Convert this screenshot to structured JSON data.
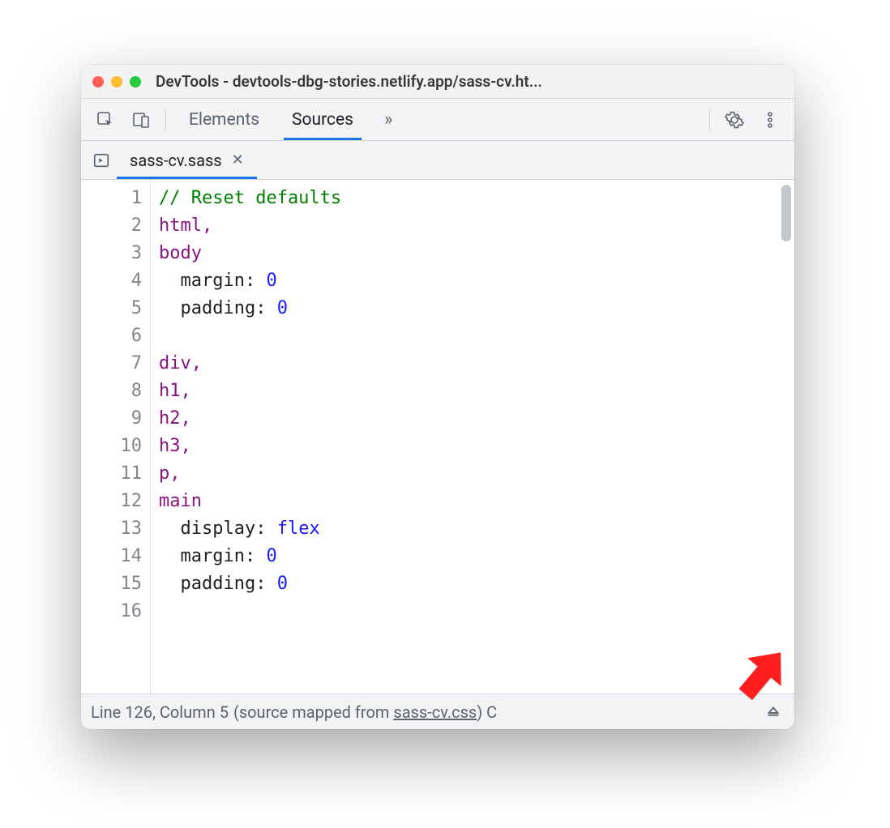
{
  "window": {
    "title": "DevTools - devtools-dbg-stories.netlify.app/sass-cv.ht..."
  },
  "panels": {
    "elements": "Elements",
    "sources": "Sources"
  },
  "file_tab": {
    "name": "sass-cv.sass"
  },
  "code_lines": [
    {
      "n": 1,
      "tokens": [
        {
          "t": "// Reset defaults",
          "c": "c-comment"
        }
      ]
    },
    {
      "n": 2,
      "tokens": [
        {
          "t": "html",
          "c": "c-sel"
        },
        {
          "t": ",",
          "c": "c-sel"
        }
      ]
    },
    {
      "n": 3,
      "tokens": [
        {
          "t": "body",
          "c": "c-sel"
        }
      ]
    },
    {
      "n": 4,
      "tokens": [
        {
          "t": "  margin",
          "c": "c-prop"
        },
        {
          "t": ": ",
          "c": ""
        },
        {
          "t": "0",
          "c": "c-val"
        }
      ]
    },
    {
      "n": 5,
      "tokens": [
        {
          "t": "  padding",
          "c": "c-prop"
        },
        {
          "t": ": ",
          "c": ""
        },
        {
          "t": "0",
          "c": "c-val"
        }
      ]
    },
    {
      "n": 6,
      "tokens": [
        {
          "t": " ",
          "c": ""
        }
      ]
    },
    {
      "n": 7,
      "tokens": [
        {
          "t": "div",
          "c": "c-sel"
        },
        {
          "t": ",",
          "c": "c-sel"
        }
      ]
    },
    {
      "n": 8,
      "tokens": [
        {
          "t": "h1",
          "c": "c-sel"
        },
        {
          "t": ",",
          "c": "c-sel"
        }
      ]
    },
    {
      "n": 9,
      "tokens": [
        {
          "t": "h2",
          "c": "c-sel"
        },
        {
          "t": ",",
          "c": "c-sel"
        }
      ]
    },
    {
      "n": 10,
      "tokens": [
        {
          "t": "h3",
          "c": "c-sel"
        },
        {
          "t": ",",
          "c": "c-sel"
        }
      ]
    },
    {
      "n": 11,
      "tokens": [
        {
          "t": "p",
          "c": "c-sel"
        },
        {
          "t": ",",
          "c": "c-sel"
        }
      ]
    },
    {
      "n": 12,
      "tokens": [
        {
          "t": "main",
          "c": "c-sel"
        }
      ]
    },
    {
      "n": 13,
      "tokens": [
        {
          "t": "  display",
          "c": "c-prop"
        },
        {
          "t": ": ",
          "c": ""
        },
        {
          "t": "flex",
          "c": "c-val"
        }
      ]
    },
    {
      "n": 14,
      "tokens": [
        {
          "t": "  margin",
          "c": "c-prop"
        },
        {
          "t": ": ",
          "c": ""
        },
        {
          "t": "0",
          "c": "c-val"
        }
      ]
    },
    {
      "n": 15,
      "tokens": [
        {
          "t": "  padding",
          "c": "c-prop"
        },
        {
          "t": ": ",
          "c": ""
        },
        {
          "t": "0",
          "c": "c-val"
        }
      ]
    },
    {
      "n": 16,
      "tokens": [
        {
          "t": " ",
          "c": ""
        }
      ]
    }
  ],
  "status": {
    "position": "Line 126, Column 5",
    "mapped_prefix": "(source mapped from ",
    "mapped_link": "sass-cv.css",
    "mapped_suffix": ")",
    "trailing": " C"
  }
}
